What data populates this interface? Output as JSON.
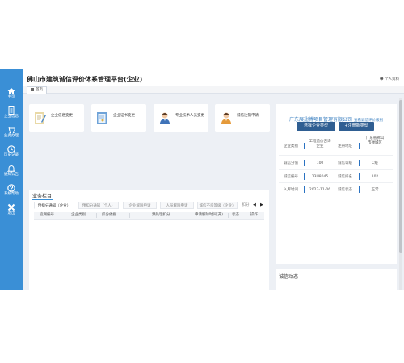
{
  "header": {
    "title": "佛山市建筑诚信评价体系管理平台(企业)",
    "user": "个人资料"
  },
  "tabs": [
    {
      "label": "首页"
    }
  ],
  "sidebar": {
    "items": [
      {
        "label": "主页",
        "icon": "home-icon"
      },
      {
        "label": "企业信息",
        "icon": "document-icon"
      },
      {
        "label": "业务办理",
        "icon": "cart-icon"
      },
      {
        "label": "历史记录",
        "icon": "clock-icon"
      },
      {
        "label": "通知公告",
        "icon": "bell-icon"
      },
      {
        "label": "系统帮助",
        "icon": "help-icon"
      },
      {
        "label": "退出",
        "icon": "close-icon"
      }
    ]
  },
  "quick_links": [
    {
      "label": "企业信息变更"
    },
    {
      "label": "企业证书变更"
    },
    {
      "label": "专业技术人员变更"
    },
    {
      "label": "诚信注销申请"
    }
  ],
  "business": {
    "title": "业务栏目",
    "tabs": [
      "预扣分通知（企业）",
      "预扣分通知（个人）",
      "企业解除申请",
      "人员解除申请",
      "诚信不良等级（企业）",
      "扣分"
    ],
    "columns": [
      "追溯编号",
      "企业类别",
      "扣分依据",
      "预处理扣分",
      "申请解除时间(开)",
      "状态",
      "操作"
    ]
  },
  "company": {
    "name": "广东展翅博项目管理有限公司",
    "link": "查看诚信评价级别",
    "buttons": [
      "选择企业类型",
      "+注册新类型"
    ],
    "info": [
      {
        "label": "企业类别",
        "value": "工程造价咨询企业",
        "label2": "注册地址",
        "value2": "广东省佛山市禅城区"
      },
      {
        "label": "诚信分值",
        "value": "100",
        "label2": "诚信等级",
        "value2": "C级"
      },
      {
        "label": "诚信编号",
        "value": "13U8045",
        "label2": "诚信排名",
        "value2": "102"
      },
      {
        "label": "入库时间",
        "value": "2023-11-06",
        "label2": "诚信状态",
        "value2": "正常"
      }
    ]
  },
  "credit": {
    "title": "诚信动态"
  },
  "colors": {
    "sidebar": "#3a8fd6",
    "button": "#2f5e92",
    "accent": "#2a72c2"
  }
}
